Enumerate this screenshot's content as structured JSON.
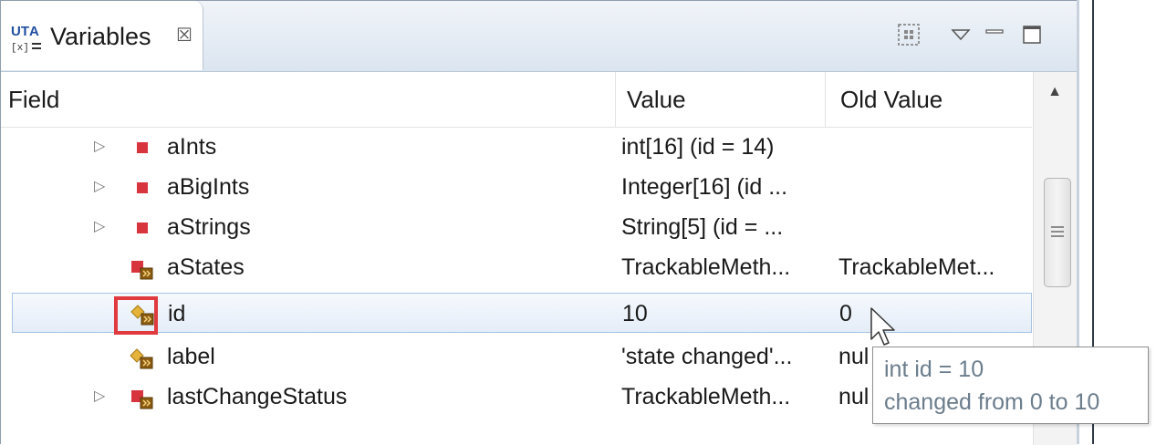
{
  "tab": {
    "title": "Variables",
    "close_glyph": "☒",
    "icon": "uta-variables-icon"
  },
  "toolbar": {
    "layout_icon": "layout-icon",
    "view_menu_icon": "view-menu-icon",
    "minimize_icon": "minimize-icon",
    "maximize_icon": "maximize-icon"
  },
  "columns": {
    "field": "Field",
    "value": "Value",
    "old_value": "Old Value"
  },
  "rows": [
    {
      "field": "aInts",
      "value": "int[16] (id = 14)",
      "old_value": "",
      "expandable": true,
      "icon": "field-private-icon"
    },
    {
      "field": "aBigInts",
      "value": "Integer[16] (id ...",
      "old_value": "",
      "expandable": true,
      "icon": "field-private-icon"
    },
    {
      "field": "aStrings",
      "value": "String[5] (id = ...",
      "old_value": "",
      "expandable": true,
      "icon": "field-private-icon"
    },
    {
      "field": "aStates",
      "value": "TrackableMeth...",
      "old_value": "TrackableMet...",
      "expandable": false,
      "icon": "field-private-changed-icon"
    },
    {
      "field": "id",
      "value": "10",
      "old_value": "0",
      "expandable": false,
      "icon": "field-protected-changed-icon",
      "selected": true
    },
    {
      "field": "label",
      "value": "'state changed'...",
      "old_value": "nul",
      "expandable": false,
      "icon": "field-protected-changed-icon"
    },
    {
      "field": "lastChangeStatus",
      "value": "TrackableMeth...",
      "old_value": "nul",
      "expandable": true,
      "icon": "field-private-changed-icon"
    }
  ],
  "tooltip": {
    "line1": "int id = 10",
    "line2": "changed from 0 to 10"
  },
  "colors": {
    "highlight": "#e0393e",
    "private_field": "#d8343e",
    "protected_field": "#e5b23a",
    "changed_badge": "#8b5b12",
    "selection_border": "#a7c3e4"
  }
}
